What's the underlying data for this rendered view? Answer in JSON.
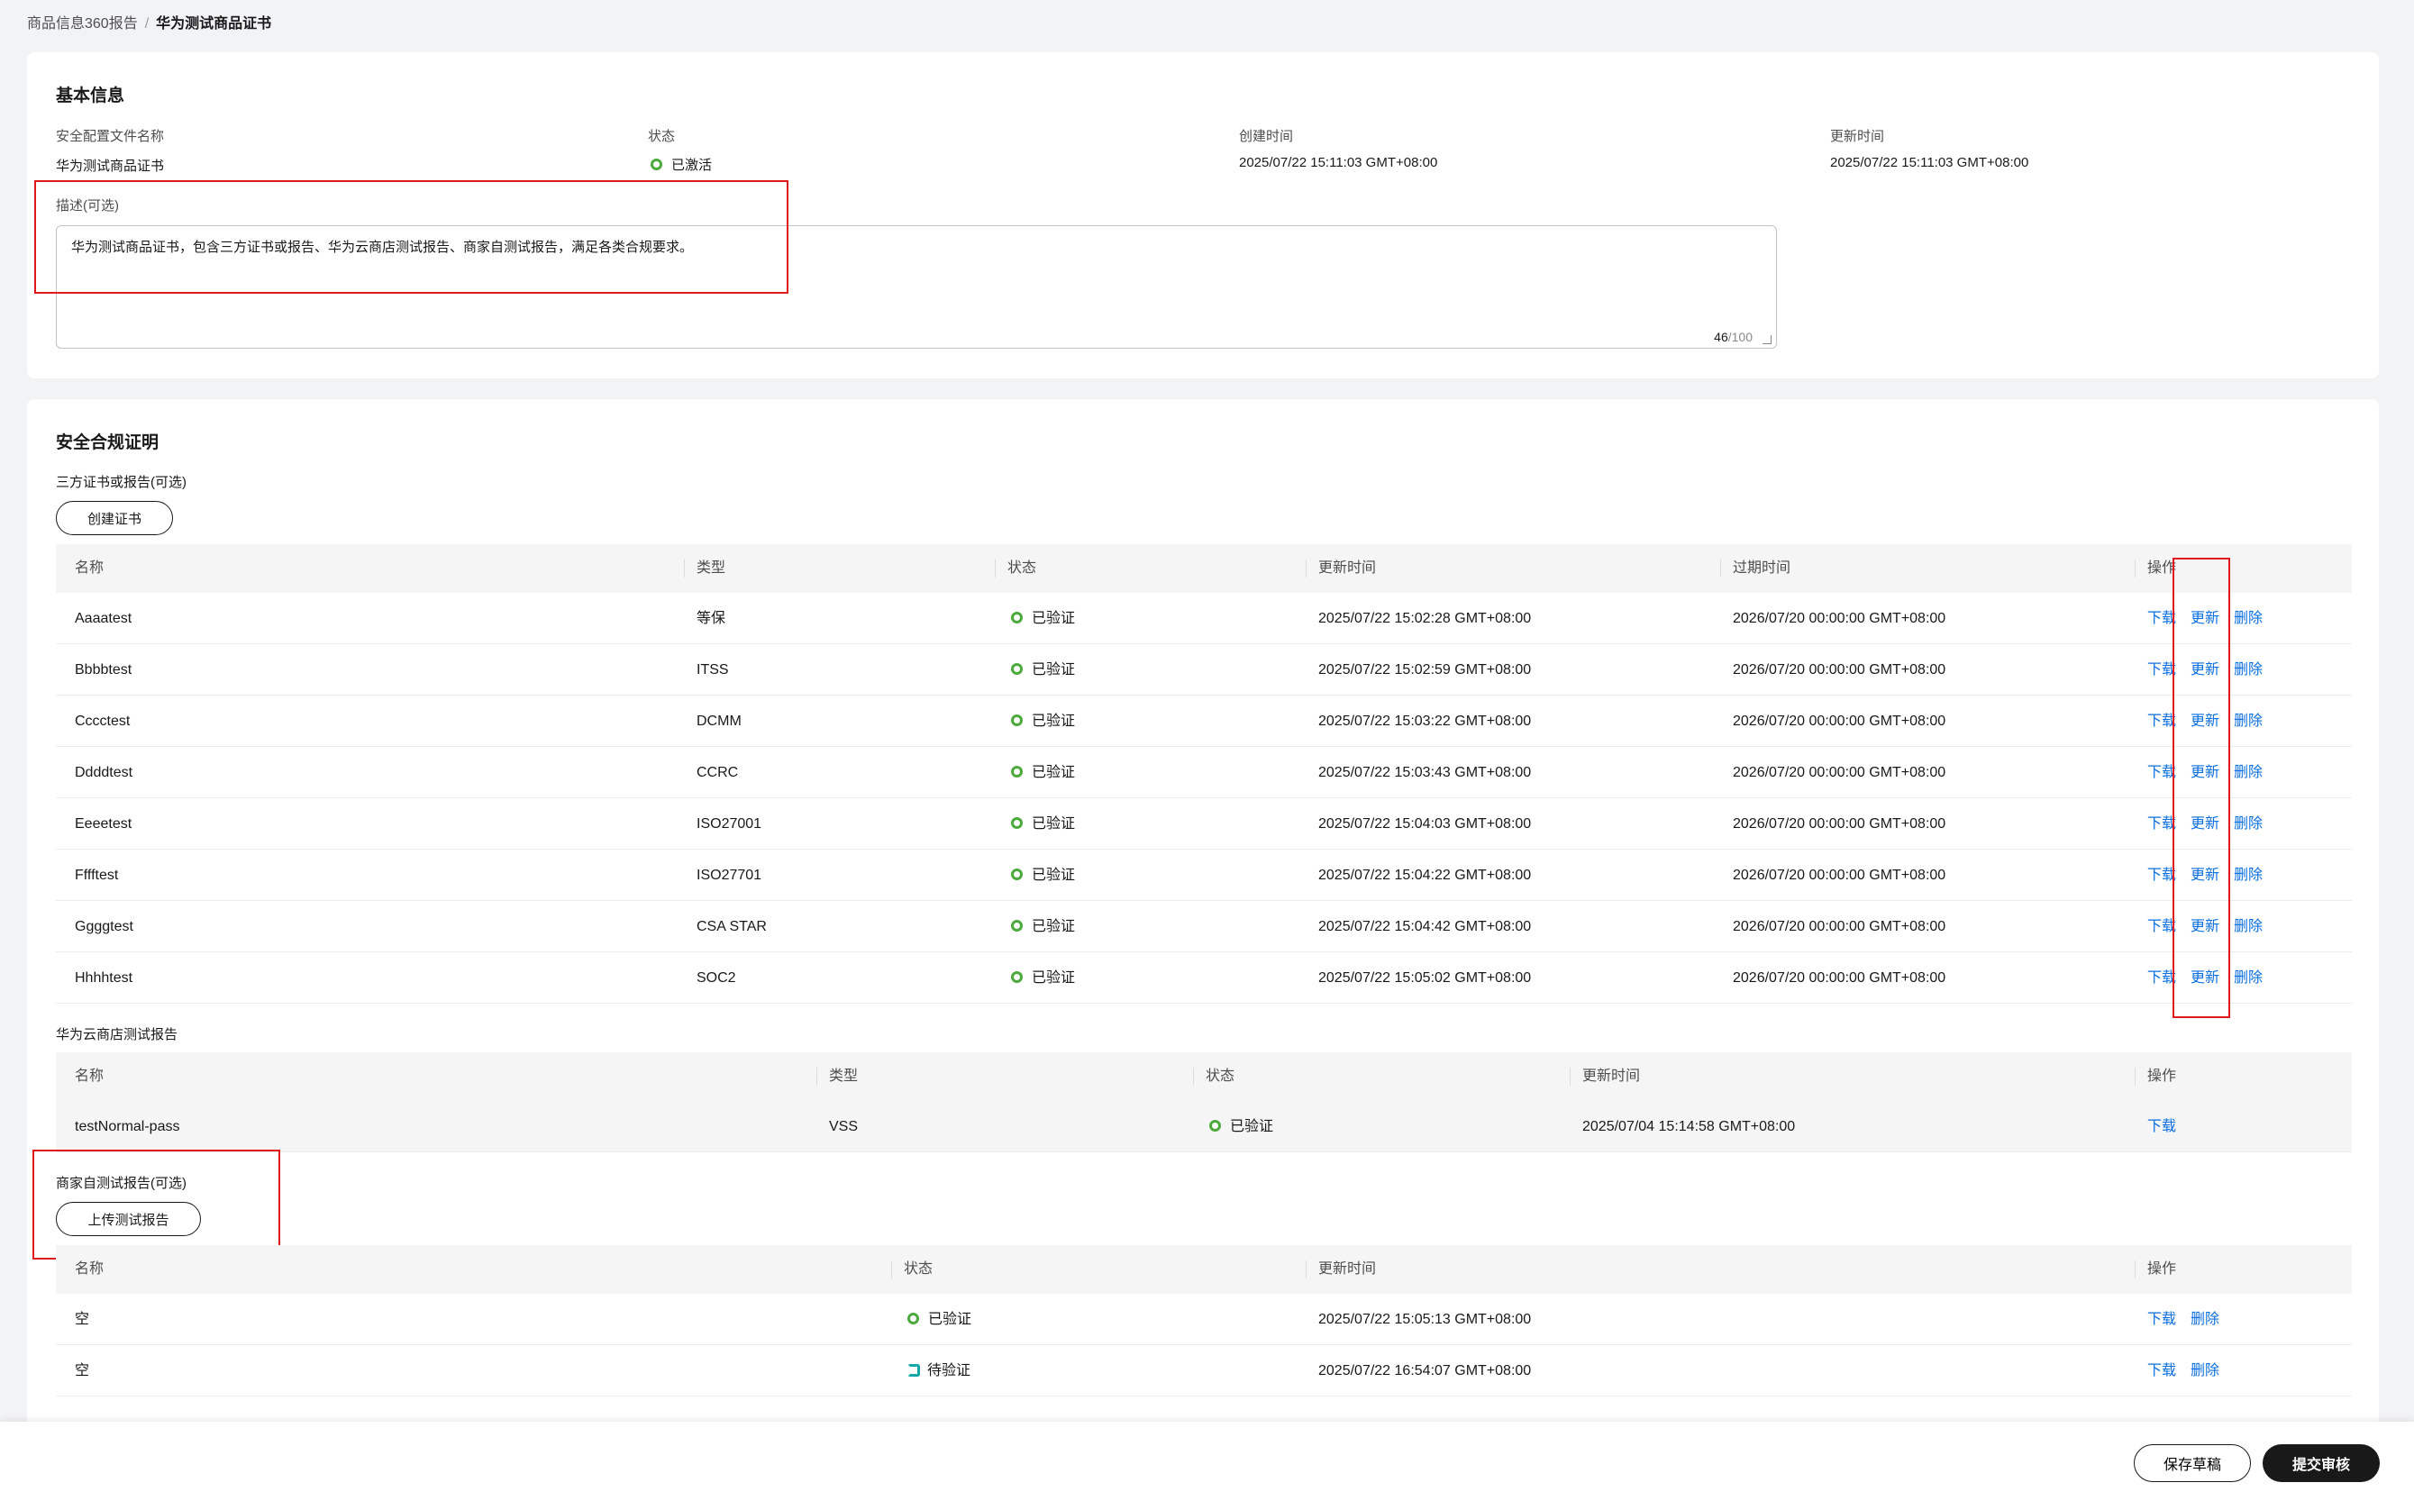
{
  "breadcrumb": {
    "parent": "商品信息360报告",
    "separator": "/",
    "current": "华为测试商品证书"
  },
  "basic": {
    "title": "基本信息",
    "fields": [
      {
        "label": "安全配置文件名称",
        "value": "华为测试商品证书"
      },
      {
        "label": "状态",
        "value": "已激活"
      },
      {
        "label": "创建时间",
        "value": "2025/07/22 15:11:03 GMT+08:00"
      },
      {
        "label": "更新时间",
        "value": "2025/07/22 15:11:03 GMT+08:00"
      }
    ],
    "description_label": "描述(可选)",
    "description": "华为测试商品证书，包含三方证书或报告、华为云商店测试报告、商家自测试报告，满足各类合规要求。",
    "counter_current": "46",
    "counter_max": "/100"
  },
  "compliance": {
    "title": "安全合规证明",
    "third_party": {
      "label": "三方证书或报告(可选)",
      "create_button": "创建证书",
      "headers": [
        "名称",
        "类型",
        "状态",
        "更新时间",
        "过期时间",
        "操作"
      ],
      "rows": [
        {
          "name": "Aaaatest",
          "type": "等保",
          "status": "已验证",
          "updated": "2025/07/22 15:02:28 GMT+08:00",
          "expires": "2026/07/20 00:00:00 GMT+08:00"
        },
        {
          "name": "Bbbbtest",
          "type": "ITSS",
          "status": "已验证",
          "updated": "2025/07/22 15:02:59 GMT+08:00",
          "expires": "2026/07/20 00:00:00 GMT+08:00"
        },
        {
          "name": "Cccctest",
          "type": "DCMM",
          "status": "已验证",
          "updated": "2025/07/22 15:03:22 GMT+08:00",
          "expires": "2026/07/20 00:00:00 GMT+08:00"
        },
        {
          "name": "Ddddtest",
          "type": "CCRC",
          "status": "已验证",
          "updated": "2025/07/22 15:03:43 GMT+08:00",
          "expires": "2026/07/20 00:00:00 GMT+08:00"
        },
        {
          "name": "Eeeetest",
          "type": "ISO27001",
          "status": "已验证",
          "updated": "2025/07/22 15:04:03 GMT+08:00",
          "expires": "2026/07/20 00:00:00 GMT+08:00"
        },
        {
          "name": "Fffftest",
          "type": "ISO27701",
          "status": "已验证",
          "updated": "2025/07/22 15:04:22 GMT+08:00",
          "expires": "2026/07/20 00:00:00 GMT+08:00"
        },
        {
          "name": "Ggggtest",
          "type": "CSA STAR",
          "status": "已验证",
          "updated": "2025/07/22 15:04:42 GMT+08:00",
          "expires": "2026/07/20 00:00:00 GMT+08:00"
        },
        {
          "name": "Hhhhtest",
          "type": "SOC2",
          "status": "已验证",
          "updated": "2025/07/22 15:05:02 GMT+08:00",
          "expires": "2026/07/20 00:00:00 GMT+08:00"
        }
      ],
      "actions": [
        "下载",
        "更新",
        "删除"
      ]
    },
    "store_test": {
      "label": "华为云商店测试报告",
      "headers": [
        "名称",
        "类型",
        "状态",
        "更新时间",
        "操作"
      ],
      "rows": [
        {
          "name": "testNormal-pass",
          "type": "VSS",
          "status": "已验证",
          "updated": "2025/07/04 15:14:58 GMT+08:00"
        }
      ],
      "actions": [
        "下载"
      ]
    },
    "self_test": {
      "label": "商家自测试报告(可选)",
      "upload_button": "上传测试报告",
      "headers": [
        "名称",
        "状态",
        "更新时间",
        "操作"
      ],
      "rows": [
        {
          "name": "空",
          "status": "已验证",
          "status_kind": "verified",
          "updated": "2025/07/22 15:05:13 GMT+08:00"
        },
        {
          "name": "空",
          "status": "待验证",
          "status_kind": "pending",
          "updated": "2025/07/22 16:54:07 GMT+08:00"
        }
      ],
      "actions": [
        "下载",
        "删除"
      ]
    }
  },
  "footer": {
    "save_label": "保存草稿",
    "submit_label": "提交审核"
  },
  "colors": {
    "link": "#0a6fe0",
    "verified": "#4caa3c",
    "pending": "#14a8a8",
    "highlight": "#e0191e"
  }
}
